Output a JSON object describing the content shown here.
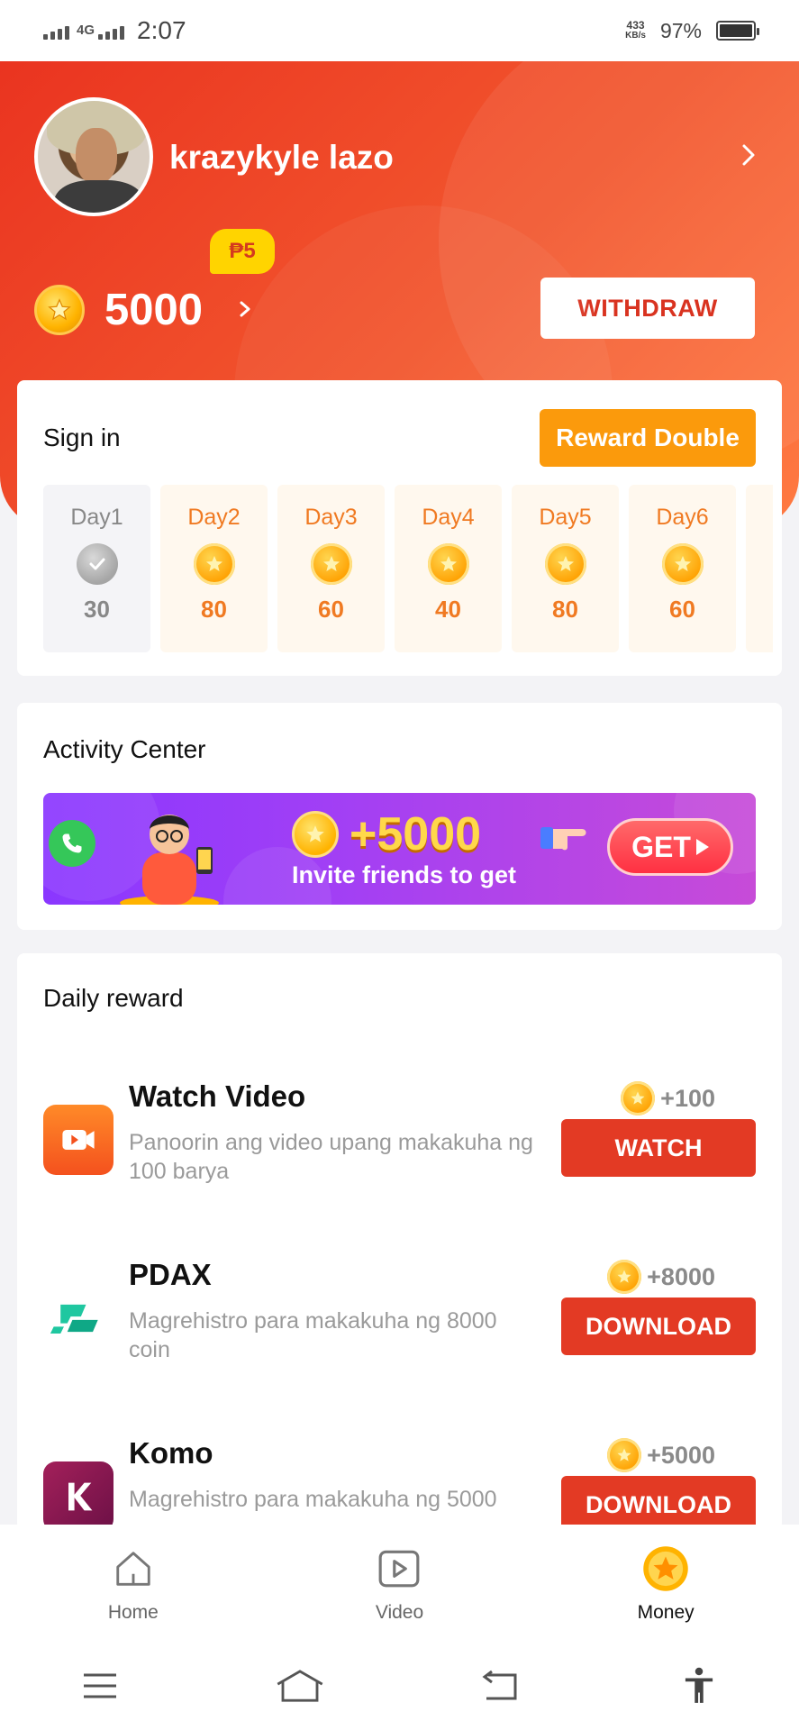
{
  "status_bar": {
    "network": "4G",
    "time": "2:07",
    "speed_value": "433",
    "speed_unit": "KB/s",
    "battery": "97%"
  },
  "profile": {
    "username": "krazykyle lazo",
    "peso_badge": "₱5",
    "coin_balance": "5000",
    "withdraw_label": "WITHDRAW"
  },
  "signin": {
    "title": "Sign in",
    "reward_double_label": "Reward Double",
    "days": [
      {
        "label": "Day1",
        "value": "30",
        "claimed": true
      },
      {
        "label": "Day2",
        "value": "80",
        "claimed": false
      },
      {
        "label": "Day3",
        "value": "60",
        "claimed": false
      },
      {
        "label": "Day4",
        "value": "40",
        "claimed": false
      },
      {
        "label": "Day5",
        "value": "80",
        "claimed": false
      },
      {
        "label": "Day6",
        "value": "60",
        "claimed": false
      }
    ]
  },
  "activity": {
    "title": "Activity Center",
    "banner_amount": "+5000",
    "banner_text": "Invite friends to get",
    "banner_button": "GET"
  },
  "daily_reward": {
    "title": "Daily reward",
    "items": [
      {
        "title": "Watch Video",
        "desc": "Panoorin ang video upang makakuha ng 100 barya",
        "amount": "+100",
        "button": "WATCH",
        "icon": "video-camera-icon"
      },
      {
        "title": "PDAX",
        "desc": "Magrehistro para makakuha ng 8000 coin",
        "amount": "+8000",
        "button": "DOWNLOAD",
        "icon": "pdax-logo-icon"
      },
      {
        "title": "Komo",
        "desc": "Magrehistro para makakuha ng 5000",
        "amount": "+5000",
        "button": "DOWNLOAD",
        "icon": "komo-logo-icon"
      }
    ]
  },
  "bottom_nav": {
    "items": [
      {
        "label": "Home",
        "icon": "home-icon"
      },
      {
        "label": "Video",
        "icon": "video-play-icon"
      },
      {
        "label": "Money",
        "icon": "coin-icon",
        "active": true
      }
    ]
  },
  "colors": {
    "header_red": "#ea3420",
    "accent_orange": "#fb9a0c",
    "button_red": "#e33a24",
    "day_orange": "#f07a22"
  }
}
